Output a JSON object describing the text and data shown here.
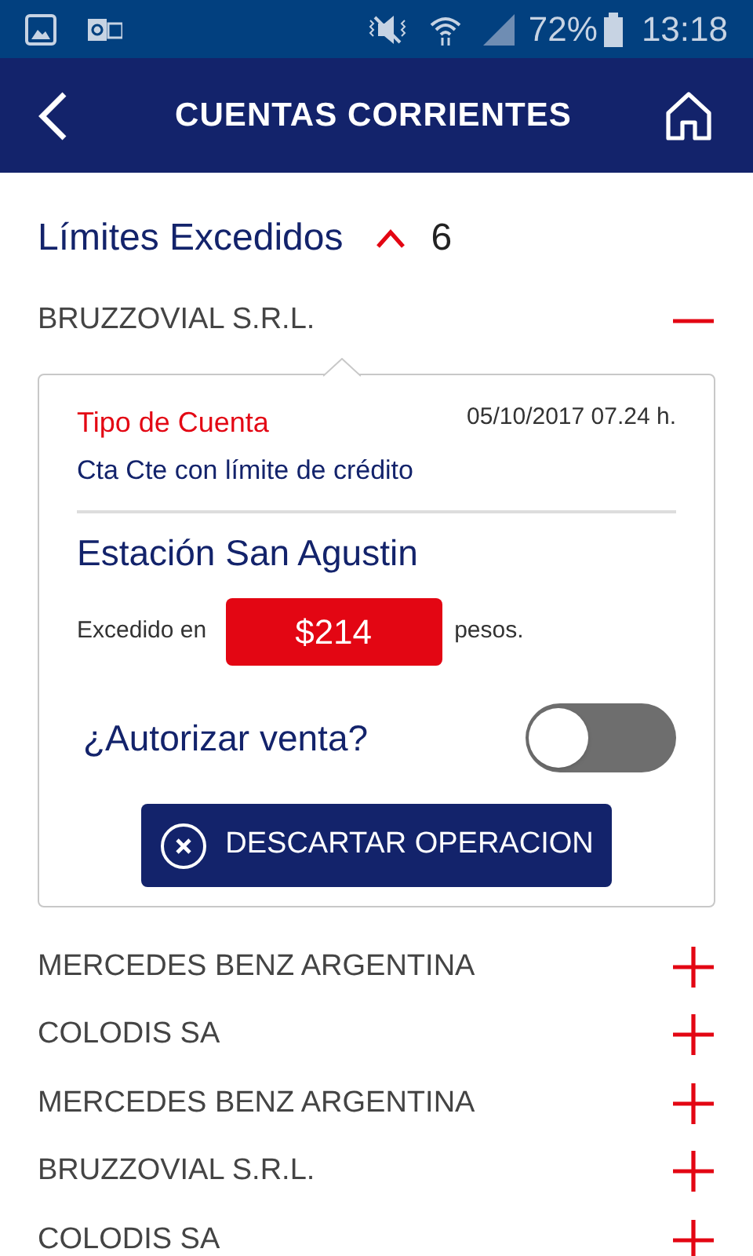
{
  "status_bar": {
    "battery": "72%",
    "time": "13:18"
  },
  "header": {
    "title": "CUENTAS CORRIENTES"
  },
  "section": {
    "title": "Límites Excedidos",
    "expanded": true,
    "count": "6"
  },
  "accounts": [
    {
      "name": "BRUZZOVIAL S.R.L.",
      "expanded": true,
      "detail": {
        "type_label": "Tipo de Cuenta",
        "date": "05/10/2017 07.24 h.",
        "type_value": "Cta Cte con límite de crédito",
        "station": "Estación San Agustin",
        "exceeded_prefix": "Excedido en",
        "amount": "$214",
        "exceeded_suffix": "pesos.",
        "authorize_label": "¿Autorizar venta?",
        "authorize_on": false,
        "discard_button": "DESCARTAR OPERACION"
      }
    },
    {
      "name": "MERCEDES BENZ ARGENTINA",
      "expanded": false
    },
    {
      "name": "COLODIS SA",
      "expanded": false
    },
    {
      "name": "MERCEDES BENZ ARGENTINA",
      "expanded": false
    },
    {
      "name": "BRUZZOVIAL S.R.L.",
      "expanded": false
    },
    {
      "name": "COLODIS SA",
      "expanded": false
    }
  ]
}
